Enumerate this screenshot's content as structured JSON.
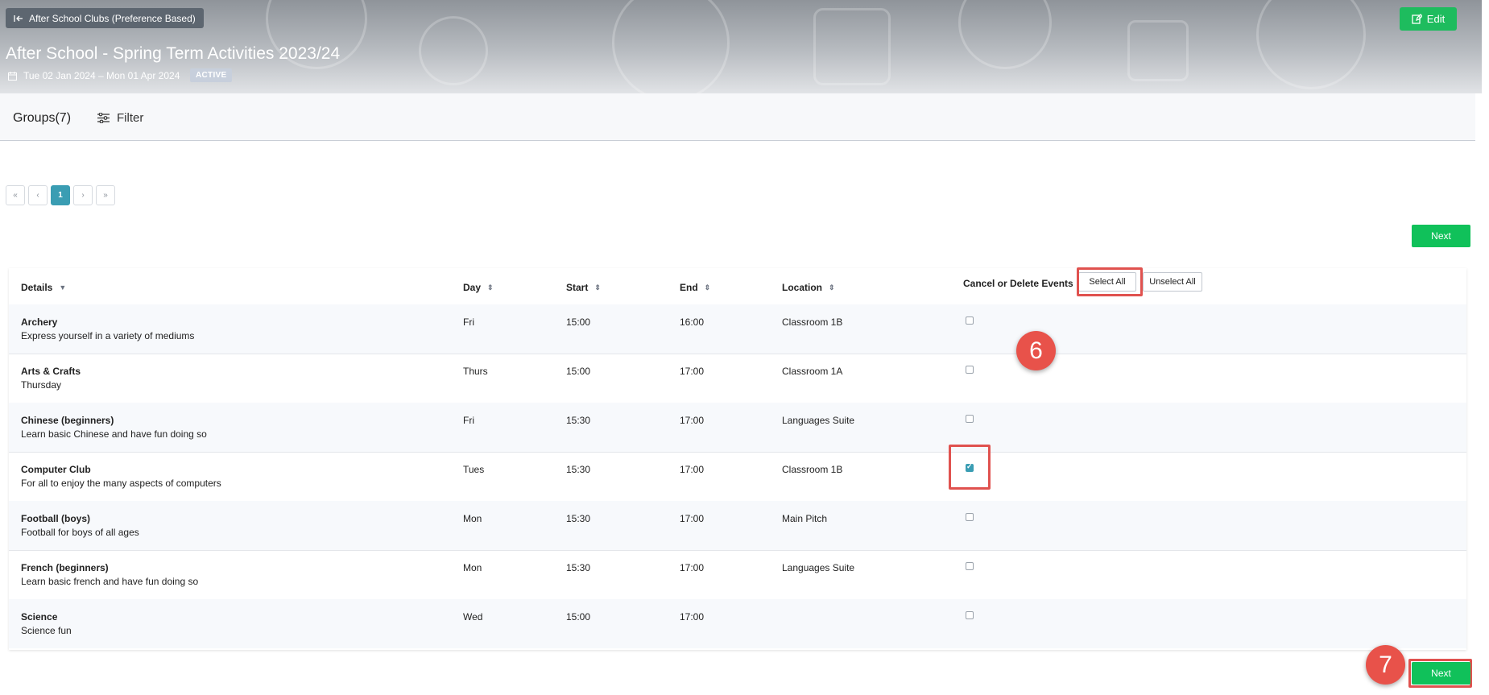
{
  "header": {
    "back_label": "After School Clubs (Preference Based)",
    "title": "After School - Spring Term Activities 2023/24",
    "date_range": "Tue 02 Jan 2024 – Mon 01 Apr 2024",
    "status_badge": "ACTIVE",
    "edit_label": "Edit"
  },
  "toolbar": {
    "groups_label": "Groups(7)",
    "filter_label": "Filter"
  },
  "pagination": {
    "first": "«",
    "prev": "‹",
    "current": "1",
    "next": "›",
    "last": "»"
  },
  "actions": {
    "next_label": "Next"
  },
  "table": {
    "headers": {
      "details": "Details",
      "day": "Day",
      "start": "Start",
      "end": "End",
      "location": "Location",
      "cancel": "Cancel or Delete Events"
    },
    "select_all_label": "Select All",
    "unselect_all_label": "Unselect All",
    "rows": [
      {
        "name": "Archery",
        "description": "Express yourself in a variety of mediums",
        "day": "Fri",
        "start": "15:00",
        "end": "16:00",
        "location": "Classroom 1B",
        "checked": false
      },
      {
        "name": "Arts & Crafts",
        "description": "Thursday",
        "day": "Thurs",
        "start": "15:00",
        "end": "17:00",
        "location": "Classroom 1A",
        "checked": false
      },
      {
        "name": "Chinese (beginners)",
        "description": "Learn basic Chinese and have fun doing so",
        "day": "Fri",
        "start": "15:30",
        "end": "17:00",
        "location": "Languages Suite",
        "checked": false
      },
      {
        "name": "Computer Club",
        "description": "For all to enjoy the many aspects of computers",
        "day": "Tues",
        "start": "15:30",
        "end": "17:00",
        "location": "Classroom 1B",
        "checked": true
      },
      {
        "name": "Football (boys)",
        "description": "Football for boys of all ages",
        "day": "Mon",
        "start": "15:30",
        "end": "17:00",
        "location": "Main Pitch",
        "checked": false
      },
      {
        "name": "French (beginners)",
        "description": "Learn basic french and have fun doing so",
        "day": "Mon",
        "start": "15:30",
        "end": "17:00",
        "location": "Languages Suite",
        "checked": false
      },
      {
        "name": "Science",
        "description": "Science fun",
        "day": "Wed",
        "start": "15:00",
        "end": "17:00",
        "location": "",
        "checked": false
      }
    ]
  },
  "callouts": {
    "step_6": "6",
    "step_7": "7"
  },
  "colors": {
    "accent_teal": "#3a9db3",
    "button_green": "#10c15a",
    "highlight_red": "#e0524f"
  }
}
